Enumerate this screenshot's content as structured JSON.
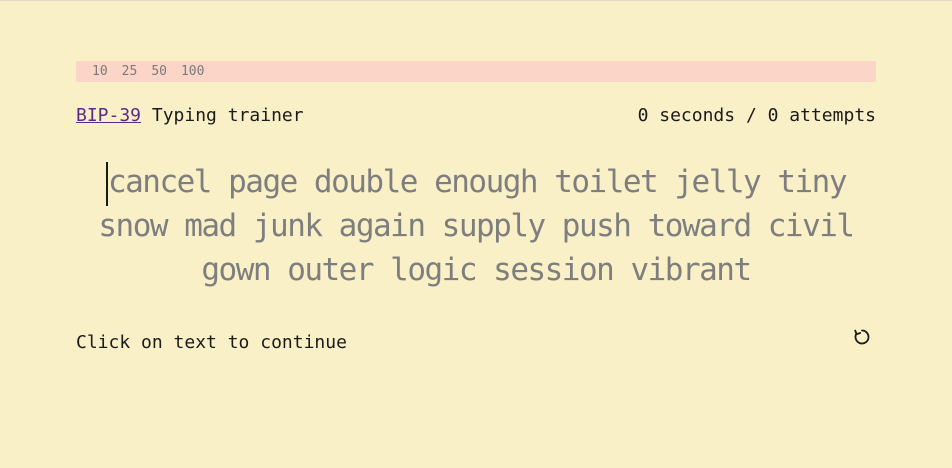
{
  "word_counts": [
    "10",
    "25",
    "50",
    "100"
  ],
  "header": {
    "link_label": "BIP-39",
    "title_suffix": " Typing trainer",
    "stats": "0 seconds / 0 attempts"
  },
  "typing": {
    "line1": "cancel page double enough toilet jelly tiny",
    "line2": "snow mad junk again supply push toward civil",
    "line3": "gown outer logic session vibrant"
  },
  "status": {
    "message": "Click on text to continue"
  },
  "icons": {
    "restart": "restart-icon"
  }
}
